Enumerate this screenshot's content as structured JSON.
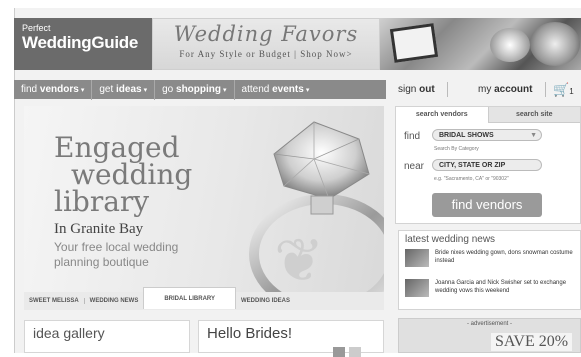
{
  "header": {
    "logo_line1": "Perfect",
    "logo_line2": "WeddingGuide",
    "banner_title": "Wedding Favors",
    "banner_subtitle": "For Any Style or Budget  |  Shop Now>"
  },
  "nav": {
    "items": [
      {
        "pre": "find ",
        "bold": "vendors",
        "caret": "▾"
      },
      {
        "pre": "get ",
        "bold": "ideas",
        "caret": "▾"
      },
      {
        "pre": "go ",
        "bold": "shopping",
        "caret": "▾"
      },
      {
        "pre": "attend ",
        "bold": "events",
        "caret": "▾"
      }
    ],
    "signout_pre": "sign ",
    "signout_bold": "out",
    "account_pre": "my ",
    "account_bold": "account",
    "cart_icon": "🛒",
    "cart_count": "1"
  },
  "hero": {
    "title_line1": "Engaged",
    "title_line2": "wedding",
    "title_line3": "library",
    "location": "In Granite Bay",
    "sub_line1": "Your free local wedding",
    "sub_line2": "planning boutique",
    "tabs": [
      "SWEET MELISSA",
      "WEDDING NEWS",
      "BRIDAL LIBRARY",
      "WEDDING IDEAS"
    ],
    "active_tab_index": 2
  },
  "search": {
    "tab_vendors": "search vendors",
    "tab_site": "search site",
    "find_label": "find",
    "find_value": "BRIDAL SHOWS",
    "find_hint": "Search By Category",
    "near_label": "near",
    "near_value": "CITY, STATE OR ZIP",
    "near_hint": "e.g. \"Sacramento, CA\" or \"90302\"",
    "button": "find vendors"
  },
  "news": {
    "heading": "latest wedding news",
    "items": [
      {
        "text": "Bride nixes wedding gown, dons snowman costume instead"
      },
      {
        "text": "Joanna Garcia and Nick Swisher set to exchange wedding vows this weekend"
      }
    ]
  },
  "ad": {
    "label": "- advertisement -",
    "save_text": "SAVE 20%"
  },
  "bottom": {
    "idea_gallery": "idea gallery",
    "hello_brides": "Hello Brides!"
  }
}
